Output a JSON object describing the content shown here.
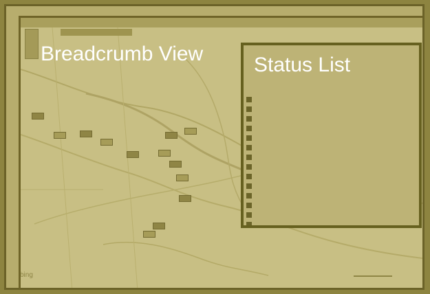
{
  "labels": {
    "breadcrumb_view": "Breadcrumb View",
    "status_list": "Status List"
  },
  "map": {
    "logo_text": "bing"
  },
  "colors": {
    "background": "#8d8440",
    "frame": "#6f6428",
    "overlay": "#c7be82",
    "heading_text": "#ffffff"
  }
}
